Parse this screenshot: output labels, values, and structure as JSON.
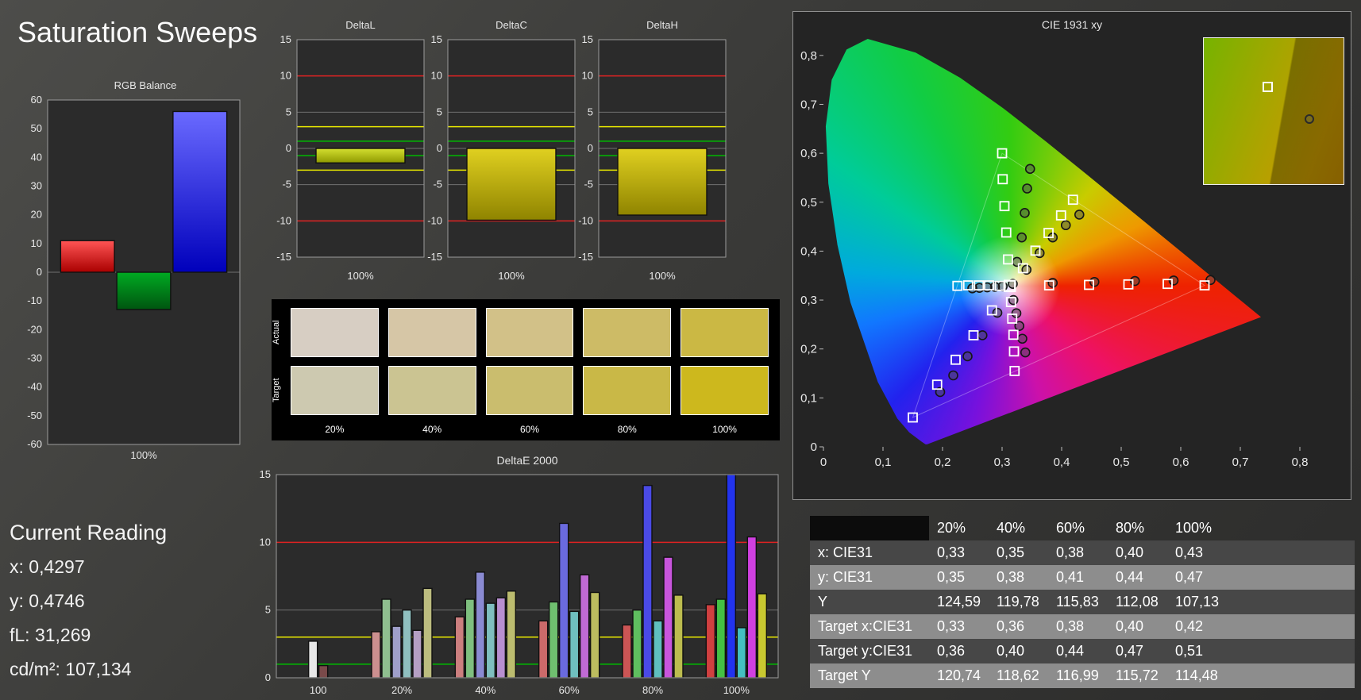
{
  "page": {
    "title": "Saturation Sweeps"
  },
  "current_reading": {
    "heading": "Current Reading",
    "lines": [
      "x: 0,4297",
      "y: 0,4746",
      "fL: 31,269",
      "cd/m²: 107,134"
    ]
  },
  "swatches": {
    "row_labels": [
      "Actual",
      "Target"
    ],
    "col_labels": [
      "20%",
      "40%",
      "60%",
      "80%",
      "100%"
    ],
    "actual_colors": [
      "#d7cec3",
      "#d6c6a6",
      "#d2c188",
      "#cdbb66",
      "#cbb844"
    ],
    "target_colors": [
      "#cdc9b0",
      "#cbc492",
      "#cabd6e",
      "#c9b847",
      "#cdb81d"
    ]
  },
  "table": {
    "columns": [
      "",
      "20%",
      "40%",
      "60%",
      "80%",
      "100%"
    ],
    "rows": [
      {
        "label": "x: CIE31",
        "values": [
          "0,33",
          "0,35",
          "0,38",
          "0,40",
          "0,43"
        ]
      },
      {
        "label": "y: CIE31",
        "values": [
          "0,35",
          "0,38",
          "0,41",
          "0,44",
          "0,47"
        ]
      },
      {
        "label": "Y",
        "values": [
          "124,59",
          "119,78",
          "115,83",
          "112,08",
          "107,13"
        ]
      },
      {
        "label": "Target x:CIE31",
        "values": [
          "0,33",
          "0,36",
          "0,38",
          "0,40",
          "0,42"
        ]
      },
      {
        "label": "Target y:CIE31",
        "values": [
          "0,36",
          "0,40",
          "0,44",
          "0,47",
          "0,51"
        ]
      },
      {
        "label": "Target Y",
        "values": [
          "120,74",
          "118,62",
          "116,99",
          "115,72",
          "114,48"
        ]
      }
    ]
  },
  "chart_data": [
    {
      "id": "rgb_balance",
      "type": "bar",
      "title": "RGB Balance",
      "ylim": [
        -60,
        60
      ],
      "ytick": 10,
      "gridlines": [
        0
      ],
      "groups": [
        {
          "label": "100%",
          "bars": [
            {
              "name": "red",
              "grad": [
                "#ff5555",
                "#aa0000"
              ],
              "v": 11
            },
            {
              "name": "green",
              "grad": [
                "#00aa22",
                "#005510"
              ],
              "v": -13
            },
            {
              "name": "blue",
              "grad": [
                "#6a6aff",
                "#0000bb"
              ],
              "v": 56
            }
          ]
        }
      ]
    },
    {
      "id": "deltaL",
      "type": "bar",
      "title": "DeltaL",
      "ylim": [
        -15,
        15
      ],
      "ytick": 5,
      "gridlines": [
        -15,
        -10,
        -5,
        0,
        5,
        10,
        15
      ],
      "ref_lines": [
        {
          "y": 10,
          "c": "#dd2222"
        },
        {
          "y": -10,
          "c": "#dd2222"
        },
        {
          "y": 3,
          "c": "#e8e800"
        },
        {
          "y": -3,
          "c": "#e8e800"
        },
        {
          "y": 1,
          "c": "#00bb00"
        },
        {
          "y": -1,
          "c": "#00bb00"
        }
      ],
      "groups": [
        {
          "label": "100%",
          "bars": [
            {
              "grad": [
                "#d4e030",
                "#8f9900"
              ],
              "v": -2.0
            }
          ]
        }
      ]
    },
    {
      "id": "deltaC",
      "type": "bar",
      "title": "DeltaC",
      "ylim": [
        -15,
        15
      ],
      "ytick": 5,
      "gridlines": [
        -15,
        -10,
        -5,
        0,
        5,
        10,
        15
      ],
      "ref_lines": [
        {
          "y": 10,
          "c": "#dd2222"
        },
        {
          "y": -10,
          "c": "#dd2222"
        },
        {
          "y": 3,
          "c": "#e8e800"
        },
        {
          "y": -3,
          "c": "#e8e800"
        },
        {
          "y": 1,
          "c": "#00bb00"
        },
        {
          "y": -1,
          "c": "#00bb00"
        }
      ],
      "groups": [
        {
          "label": "100%",
          "bars": [
            {
              "grad": [
                "#e0d020",
                "#8f8400"
              ],
              "v": -9.9
            }
          ]
        }
      ]
    },
    {
      "id": "deltaH",
      "type": "bar",
      "title": "DeltaH",
      "ylim": [
        -15,
        15
      ],
      "ytick": 5,
      "gridlines": [
        -15,
        -10,
        -5,
        0,
        5,
        10,
        15
      ],
      "ref_lines": [
        {
          "y": 10,
          "c": "#dd2222"
        },
        {
          "y": -10,
          "c": "#dd2222"
        },
        {
          "y": 3,
          "c": "#e8e800"
        },
        {
          "y": -3,
          "c": "#e8e800"
        },
        {
          "y": 1,
          "c": "#00bb00"
        },
        {
          "y": -1,
          "c": "#00bb00"
        }
      ],
      "groups": [
        {
          "label": "100%",
          "bars": [
            {
              "grad": [
                "#e0d020",
                "#8f8400"
              ],
              "v": -9.2
            }
          ]
        }
      ]
    },
    {
      "id": "deltaE2000",
      "type": "bar",
      "title": "DeltaE 2000",
      "ylim": [
        0,
        15
      ],
      "ytick": 5,
      "gridlines": [
        5,
        15
      ],
      "ref_lines": [
        {
          "y": 10,
          "c": "#dd2222"
        },
        {
          "y": 3,
          "c": "#e8e800"
        },
        {
          "y": 1,
          "c": "#00bb00"
        }
      ],
      "groups": [
        {
          "label": "100",
          "bars": [
            {
              "c": "#e8e8e8",
              "v": 2.7
            },
            {
              "c": "#7a4a4a",
              "v": 0.9
            }
          ]
        },
        {
          "label": "20%",
          "bars": [
            {
              "c": "#cc8f8f",
              "v": 3.4
            },
            {
              "c": "#8fbf8f",
              "v": 5.8
            },
            {
              "c": "#9f9fca",
              "v": 3.8
            },
            {
              "c": "#8fbfbf",
              "v": 5.0
            },
            {
              "c": "#b49fc4",
              "v": 3.5
            },
            {
              "c": "#bcbc7f",
              "v": 6.6
            }
          ]
        },
        {
          "label": "40%",
          "bars": [
            {
              "c": "#cc7f7f",
              "v": 4.5
            },
            {
              "c": "#7fbf7f",
              "v": 5.8
            },
            {
              "c": "#8a8ad2",
              "v": 7.8
            },
            {
              "c": "#7fbfbf",
              "v": 5.5
            },
            {
              "c": "#b88fd0",
              "v": 5.9
            },
            {
              "c": "#bcbc6f",
              "v": 6.4
            }
          ]
        },
        {
          "label": "60%",
          "bars": [
            {
              "c": "#cc6a6a",
              "v": 4.2
            },
            {
              "c": "#6fbf6f",
              "v": 5.6
            },
            {
              "c": "#6a6ade",
              "v": 11.4
            },
            {
              "c": "#6fbfbf",
              "v": 4.9
            },
            {
              "c": "#c06ad4",
              "v": 7.6
            },
            {
              "c": "#bcbc5f",
              "v": 6.3
            }
          ]
        },
        {
          "label": "80%",
          "bars": [
            {
              "c": "#cc5555",
              "v": 3.9
            },
            {
              "c": "#5fbf5f",
              "v": 5.0
            },
            {
              "c": "#4a4ae6",
              "v": 14.2
            },
            {
              "c": "#5fbfbf",
              "v": 4.2
            },
            {
              "c": "#c855dc",
              "v": 8.9
            },
            {
              "c": "#bcbc4f",
              "v": 6.1
            }
          ]
        },
        {
          "label": "100%",
          "bars": [
            {
              "c": "#d04040",
              "v": 5.4
            },
            {
              "c": "#44c044",
              "v": 5.8
            },
            {
              "c": "#2233ee",
              "v": 15.0
            },
            {
              "c": "#44c0c0",
              "v": 3.7
            },
            {
              "c": "#d040e0",
              "v": 10.4
            },
            {
              "c": "#c8c830",
              "v": 6.2
            }
          ]
        }
      ]
    },
    {
      "id": "cie1931",
      "type": "scatter",
      "title": "CIE 1931 xy",
      "xlim": [
        0,
        0.8
      ],
      "ylim": [
        0,
        0.85
      ],
      "xticks": [
        "0",
        "0,1",
        "0,2",
        "0,3",
        "0,4",
        "0,5",
        "0,6",
        "0,7",
        "0,8"
      ],
      "yticks": [
        "0",
        "0,1",
        "0,2",
        "0,3",
        "0,4",
        "0,5",
        "0,6",
        "0,7",
        "0,8"
      ],
      "triangle": [
        [
          0.64,
          0.33
        ],
        [
          0.3,
          0.6
        ],
        [
          0.15,
          0.06
        ]
      ],
      "targets": [
        [
          0.313,
          0.329
        ],
        [
          0.379,
          0.33
        ],
        [
          0.446,
          0.331
        ],
        [
          0.512,
          0.332
        ],
        [
          0.578,
          0.333
        ],
        [
          0.64,
          0.33
        ],
        [
          0.31,
          0.383
        ],
        [
          0.307,
          0.438
        ],
        [
          0.304,
          0.492
        ],
        [
          0.301,
          0.547
        ],
        [
          0.3,
          0.6
        ],
        [
          0.283,
          0.279
        ],
        [
          0.252,
          0.228
        ],
        [
          0.222,
          0.178
        ],
        [
          0.191,
          0.127
        ],
        [
          0.15,
          0.06
        ],
        [
          0.296,
          0.329
        ],
        [
          0.278,
          0.33
        ],
        [
          0.261,
          0.33
        ],
        [
          0.243,
          0.33
        ],
        [
          0.225,
          0.329
        ],
        [
          0.315,
          0.296
        ],
        [
          0.317,
          0.262
        ],
        [
          0.319,
          0.229
        ],
        [
          0.32,
          0.195
        ],
        [
          0.321,
          0.155
        ],
        [
          0.335,
          0.365
        ],
        [
          0.356,
          0.401
        ],
        [
          0.378,
          0.437
        ],
        [
          0.399,
          0.473
        ],
        [
          0.419,
          0.505
        ]
      ],
      "measurements": [
        [
          0.318,
          0.333
        ],
        [
          0.385,
          0.335
        ],
        [
          0.455,
          0.337
        ],
        [
          0.523,
          0.339
        ],
        [
          0.588,
          0.34
        ],
        [
          0.65,
          0.341
        ],
        [
          0.325,
          0.378
        ],
        [
          0.333,
          0.428
        ],
        [
          0.338,
          0.478
        ],
        [
          0.342,
          0.528
        ],
        [
          0.347,
          0.568
        ],
        [
          0.292,
          0.274
        ],
        [
          0.267,
          0.228
        ],
        [
          0.242,
          0.185
        ],
        [
          0.218,
          0.146
        ],
        [
          0.196,
          0.112
        ],
        [
          0.301,
          0.328
        ],
        [
          0.288,
          0.327
        ],
        [
          0.275,
          0.326
        ],
        [
          0.262,
          0.325
        ],
        [
          0.25,
          0.324
        ],
        [
          0.319,
          0.3
        ],
        [
          0.324,
          0.273
        ],
        [
          0.329,
          0.247
        ],
        [
          0.334,
          0.221
        ],
        [
          0.339,
          0.193
        ],
        [
          0.341,
          0.362
        ],
        [
          0.363,
          0.396
        ],
        [
          0.385,
          0.428
        ],
        [
          0.407,
          0.453
        ],
        [
          0.4297,
          0.4746
        ]
      ],
      "inset": {
        "square": {
          "x": 0.42,
          "y": 0.3
        },
        "circle": {
          "x": 0.72,
          "y": 0.52
        }
      }
    }
  ]
}
